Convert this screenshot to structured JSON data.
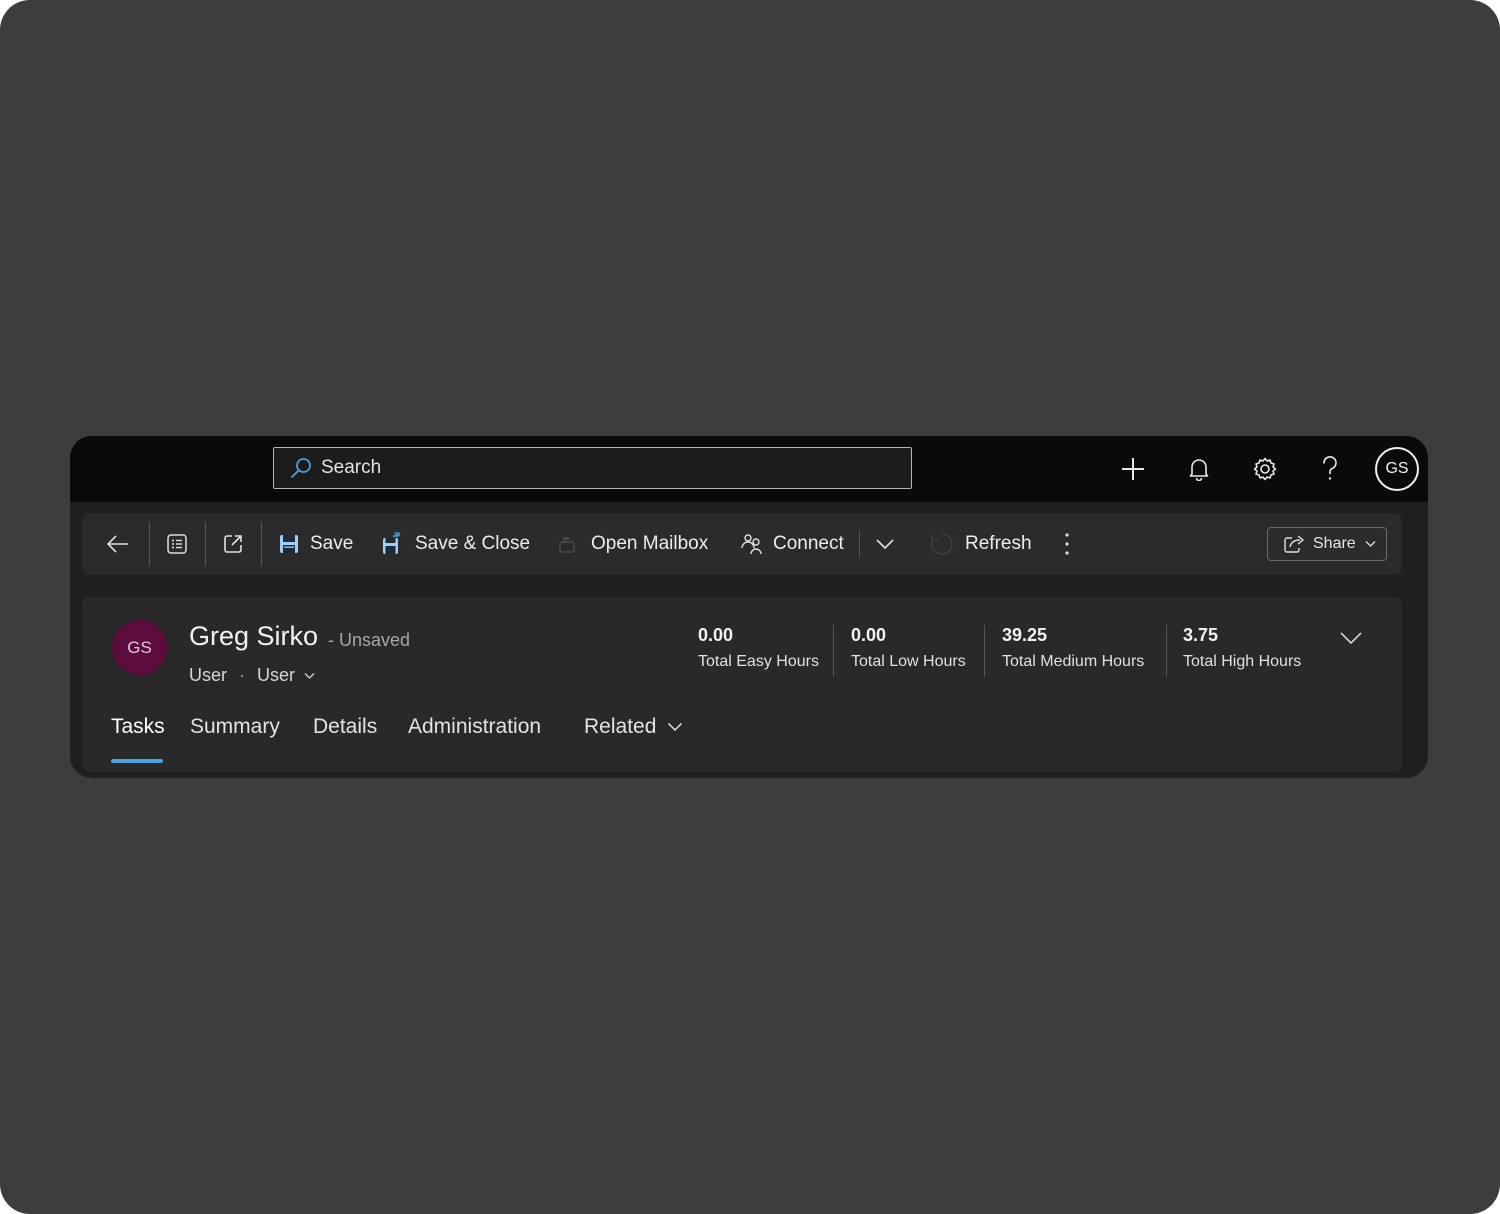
{
  "topbar": {
    "search_placeholder": "Search",
    "icons": [
      "add-icon",
      "bell-icon",
      "gear-icon",
      "help-icon"
    ],
    "user_initials": "GS"
  },
  "toolbar": {
    "save_label": "Save",
    "save_close_label": "Save & Close",
    "open_mailbox_label": "Open Mailbox",
    "connect_label": "Connect",
    "refresh_label": "Refresh",
    "share_label": "Share"
  },
  "record": {
    "initials": "GS",
    "name": "Greg Sirko",
    "status": "- Unsaved",
    "entity": "User",
    "dot": "·",
    "form": "User",
    "avatar_color": "#5c0d3d"
  },
  "stats": [
    {
      "value": "0.00",
      "label": "Total Easy Hours"
    },
    {
      "value": "0.00",
      "label": "Total Low Hours"
    },
    {
      "value": "39.25",
      "label": "Total Medium Hours"
    },
    {
      "value": "3.75",
      "label": "Total High Hours"
    }
  ],
  "tabs": [
    {
      "label": "Tasks",
      "active": true
    },
    {
      "label": "Summary"
    },
    {
      "label": "Details"
    },
    {
      "label": "Administration"
    },
    {
      "label": "Related"
    }
  ],
  "colors": {
    "accent": "#4aa3df"
  }
}
